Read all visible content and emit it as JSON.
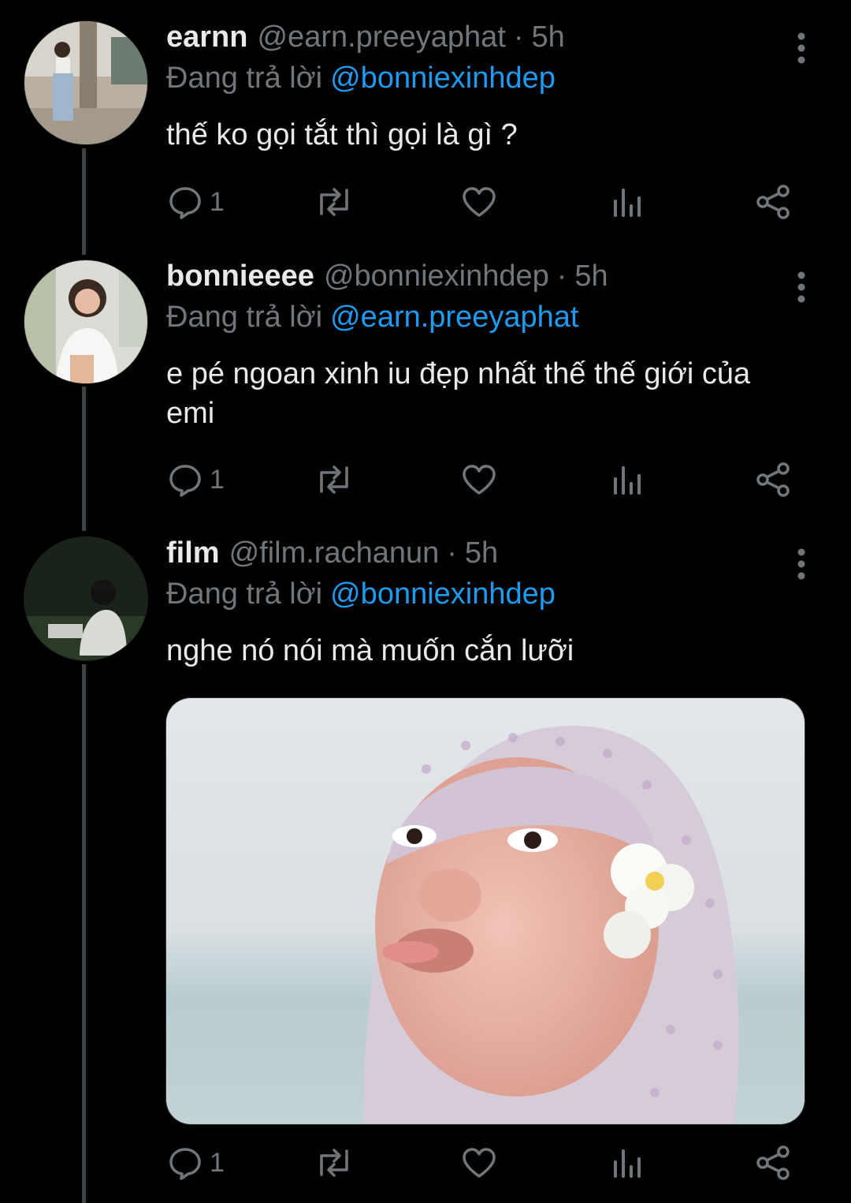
{
  "tweets": [
    {
      "name": "earnn",
      "handle": "@earn.preeyaphat",
      "sep": "·",
      "time": "5h",
      "reply_prefix": "Đang trả lời",
      "reply_to": "@bonniexinhdep",
      "text_lines": [
        "thế ko gọi tắt thì gọi là gì ?"
      ],
      "reply_count": "1"
    },
    {
      "name": "bonnieeee",
      "handle": "@bonniexinhdep",
      "sep": "·",
      "time": "5h",
      "reply_prefix": "Đang trả lời",
      "reply_to": "@earn.preeyaphat",
      "text_lines": [
        "e pé ngoan xinh iu đẹp nhất thế thế giới của",
        "emi"
      ],
      "reply_count": "1"
    },
    {
      "name": "film",
      "handle": "@film.rachanun",
      "sep": "·",
      "time": "5h",
      "reply_prefix": "Đang trả lời",
      "reply_to": "@bonniexinhdep",
      "text_lines": [
        "nghe nó nói mà muốn cắn lưỡi"
      ],
      "reply_count": "1"
    }
  ],
  "icons": {
    "reply": "reply-icon",
    "retweet": "retweet-icon",
    "like": "like-icon",
    "views": "views-icon",
    "share": "share-icon",
    "more": "more-vertical-icon"
  },
  "colors": {
    "background": "#000000",
    "text": "#e7e9ea",
    "muted": "#71767b",
    "mention": "#1d9bf0",
    "thread_line": "#3e4144"
  }
}
